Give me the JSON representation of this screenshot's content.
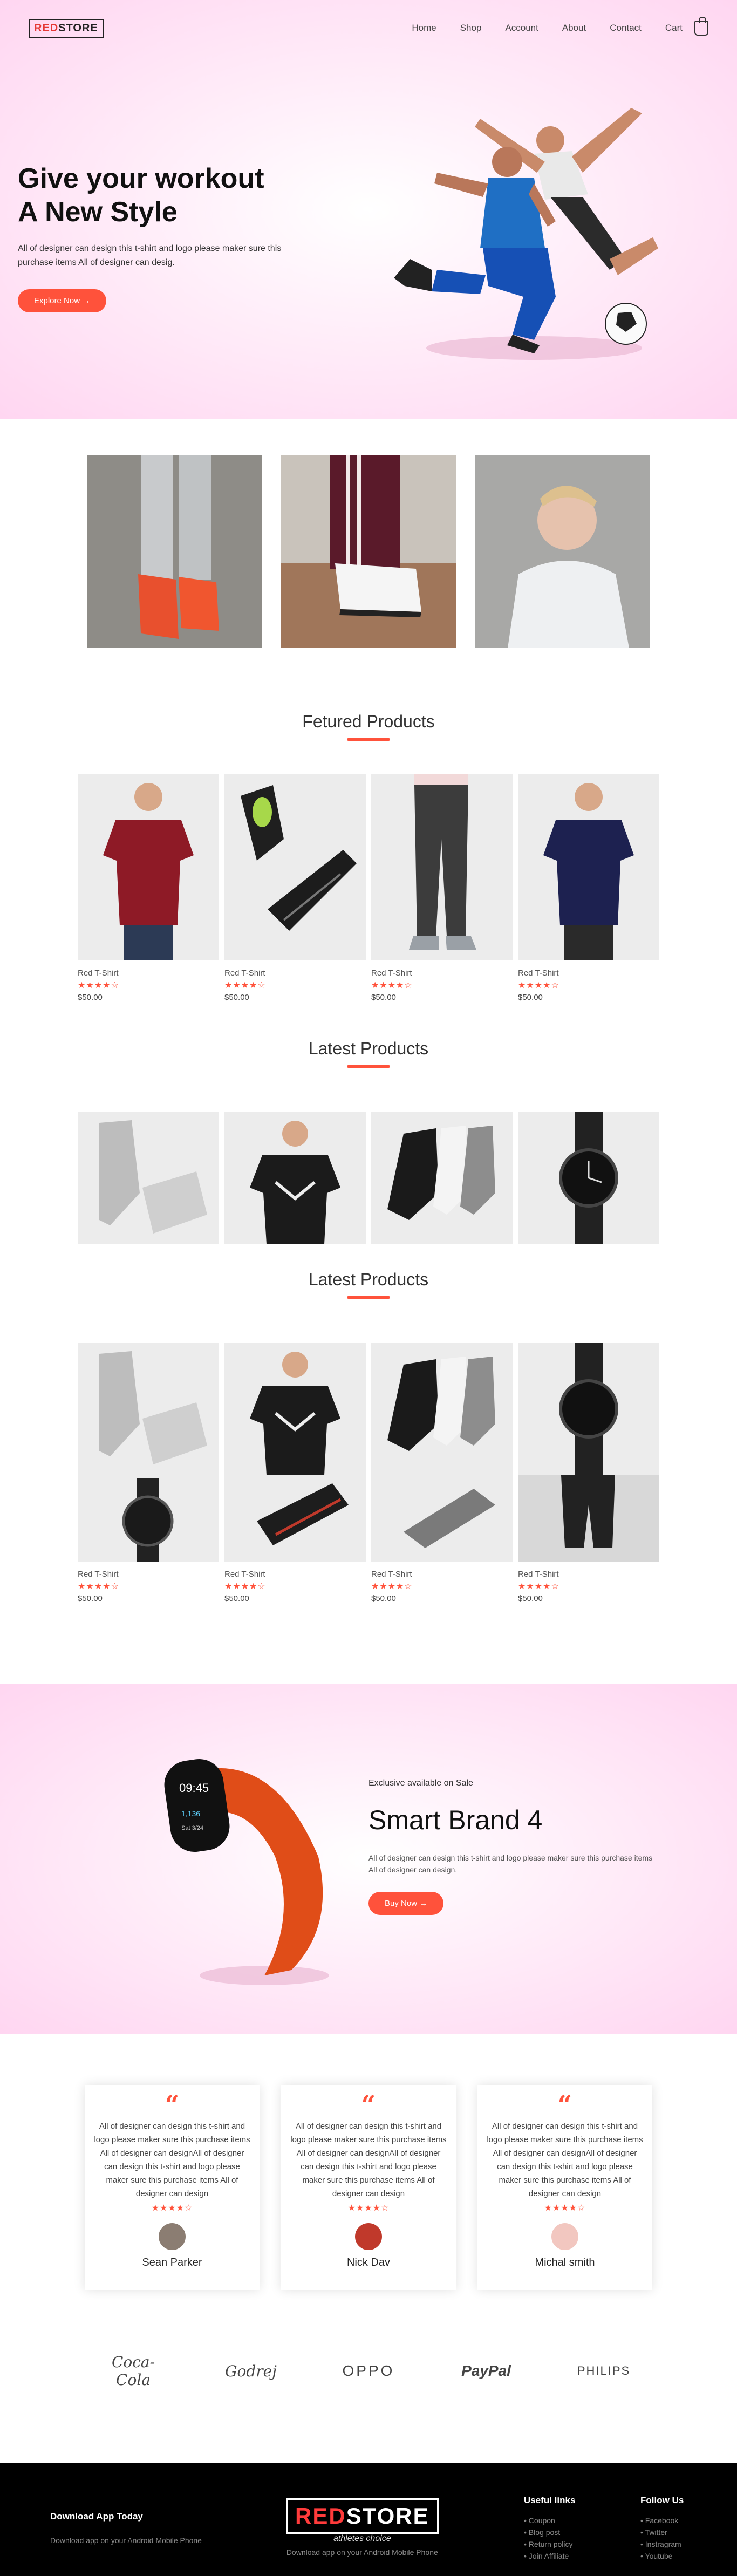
{
  "brand": {
    "red": "RED",
    "black": "STORE",
    "tagline": "athletes choice"
  },
  "nav": [
    "Home",
    "Shop",
    "Account",
    "About",
    "Contact",
    "Cart"
  ],
  "hero": {
    "line1": "Give your workout",
    "line2": "A New Style",
    "text": "All of designer can design this t-shirt and logo please maker sure this purchase items All of designer can desig.",
    "button": "Explore Now →"
  },
  "featured_title": "Fetured Products",
  "latest_title": "Latest Products",
  "latest_title_2": "Latest Products",
  "product_name": "Red T-Shirt",
  "product_stars": "★★★★☆",
  "product_price": "$50.00",
  "offer": {
    "small": "Exclusive available on Sale",
    "title": "Smart Brand 4",
    "text": "All of designer can design this t-shirt and logo please maker sure this purchase items All of designer can design.",
    "button": "Buy Now →",
    "band_time": "09:45",
    "band_steps": "1,136",
    "band_date": "Sat 3/24"
  },
  "testimonial_text": "All of designer can design this t-shirt and logo please maker sure this purchase items All of designer can designAll of designer can design this t-shirt and logo please maker sure this purchase items All of designer can design",
  "testimonials": [
    {
      "name": "Sean Parker"
    },
    {
      "name": "Nick Dav"
    },
    {
      "name": "Michal smith"
    }
  ],
  "brands": [
    "Coca-Cola",
    "Godrej",
    "OPPO",
    "PayPal",
    "PHILIPS"
  ],
  "footer": {
    "app_title": "Download App Today",
    "app_text": "Download app on your Android Mobile Phone",
    "center_text": "Download app on your Android Mobile Phone",
    "useful_title": "Useful links",
    "useful": [
      "Coupon",
      "Blog post",
      "Return policy",
      "Join Affiliate"
    ],
    "follow_title": "Follow Us",
    "follow": [
      "Facebook",
      "Twitter",
      "Instragram",
      "Youtube"
    ]
  },
  "colors": {
    "accent": "#ff523b",
    "pink": "#ffd6f1"
  }
}
